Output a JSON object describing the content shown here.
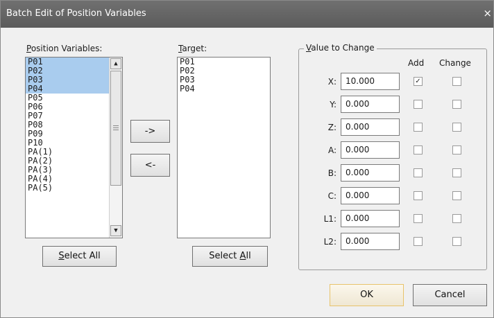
{
  "window": {
    "title": "Batch Edit of Position Variables",
    "close_glyph": "×"
  },
  "position_list": {
    "label_key": "P",
    "label_rest": "osition Variables:",
    "items": [
      {
        "text": "P01",
        "selected": true
      },
      {
        "text": "P02",
        "selected": true
      },
      {
        "text": "P03",
        "selected": true
      },
      {
        "text": "P04",
        "selected": true
      },
      {
        "text": "P05",
        "selected": false
      },
      {
        "text": "P06",
        "selected": false
      },
      {
        "text": "P07",
        "selected": false
      },
      {
        "text": "P08",
        "selected": false
      },
      {
        "text": "P09",
        "selected": false
      },
      {
        "text": "P10",
        "selected": false
      },
      {
        "text": "PA(1)",
        "selected": false
      },
      {
        "text": "PA(2)",
        "selected": false
      },
      {
        "text": "PA(3)",
        "selected": false
      },
      {
        "text": "PA(4)",
        "selected": false
      },
      {
        "text": "PA(5)",
        "selected": false
      }
    ],
    "select_all_key": "S",
    "select_all_rest": "elect All"
  },
  "transfer": {
    "add_label": "->",
    "remove_label": "<-"
  },
  "target_list": {
    "label_key": "T",
    "label_rest": "arget:",
    "items": [
      {
        "text": "P01"
      },
      {
        "text": "P02"
      },
      {
        "text": "P03"
      },
      {
        "text": "P04"
      }
    ],
    "select_all_prefix": "Select ",
    "select_all_key": "A",
    "select_all_rest": "ll"
  },
  "value_group": {
    "title_key": "V",
    "title_rest": "alue to Change",
    "col_add": "Add",
    "col_change": "Change",
    "rows": [
      {
        "label": "X:",
        "value": "10.000",
        "add": true,
        "change": false
      },
      {
        "label": "Y:",
        "value": "0.000",
        "add": false,
        "change": false
      },
      {
        "label": "Z:",
        "value": "0.000",
        "add": false,
        "change": false
      },
      {
        "label": "A:",
        "value": "0.000",
        "add": false,
        "change": false
      },
      {
        "label": "B:",
        "value": "0.000",
        "add": false,
        "change": false
      },
      {
        "label": "C:",
        "value": "0.000",
        "add": false,
        "change": false
      },
      {
        "label": "L1:",
        "value": "0.000",
        "add": false,
        "change": false
      },
      {
        "label": "L2:",
        "value": "0.000",
        "add": false,
        "change": false
      }
    ]
  },
  "buttons": {
    "ok": "OK",
    "cancel": "Cancel"
  },
  "icons": {
    "check": "✓",
    "arrow_up": "▲",
    "arrow_down": "▼"
  },
  "colors": {
    "selection": "#a9ccee",
    "titlebar": "#636363",
    "default_button_border": "#e8c36a"
  }
}
